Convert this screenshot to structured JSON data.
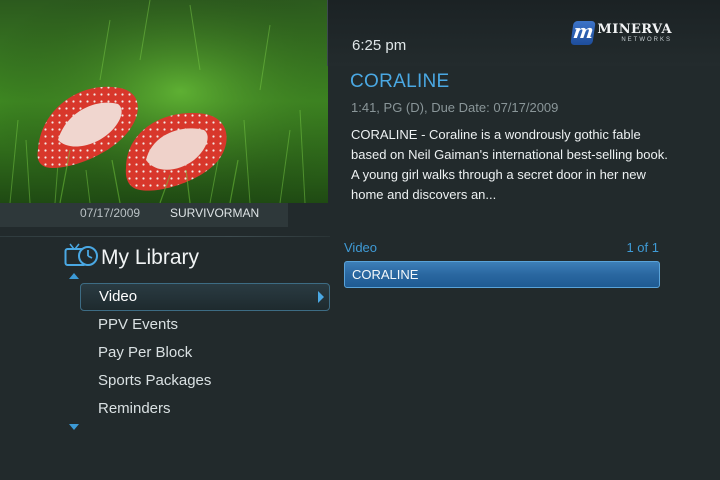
{
  "header": {
    "clock": "6:25 pm",
    "brand": {
      "name": "MINERVA",
      "sub": "NETWORKS",
      "mark": "m"
    }
  },
  "detail": {
    "title": "CORALINE",
    "meta": "1:41, PG (D), Due Date: 07/17/2009",
    "description": "CORALINE - Coraline is a wondrously gothic fable based on Neil Gaiman's international best-selling book. A young girl walks through a secret door in her new home and discovers an..."
  },
  "thumbnail": {
    "date": "07/17/2009",
    "show": "SURVIVORMAN"
  },
  "library": {
    "title": "My Library",
    "items": [
      {
        "label": "Video",
        "selected": true
      },
      {
        "label": "PPV Events"
      },
      {
        "label": "Pay Per Block"
      },
      {
        "label": "Sports Packages"
      },
      {
        "label": "Reminders"
      }
    ]
  },
  "list": {
    "category": "Video",
    "count": "1 of 1",
    "rows": [
      {
        "label": "CORALINE"
      }
    ]
  },
  "colors": {
    "accent": "#4aa8e3",
    "background": "#222a2c",
    "selection": "#2a67a0"
  }
}
